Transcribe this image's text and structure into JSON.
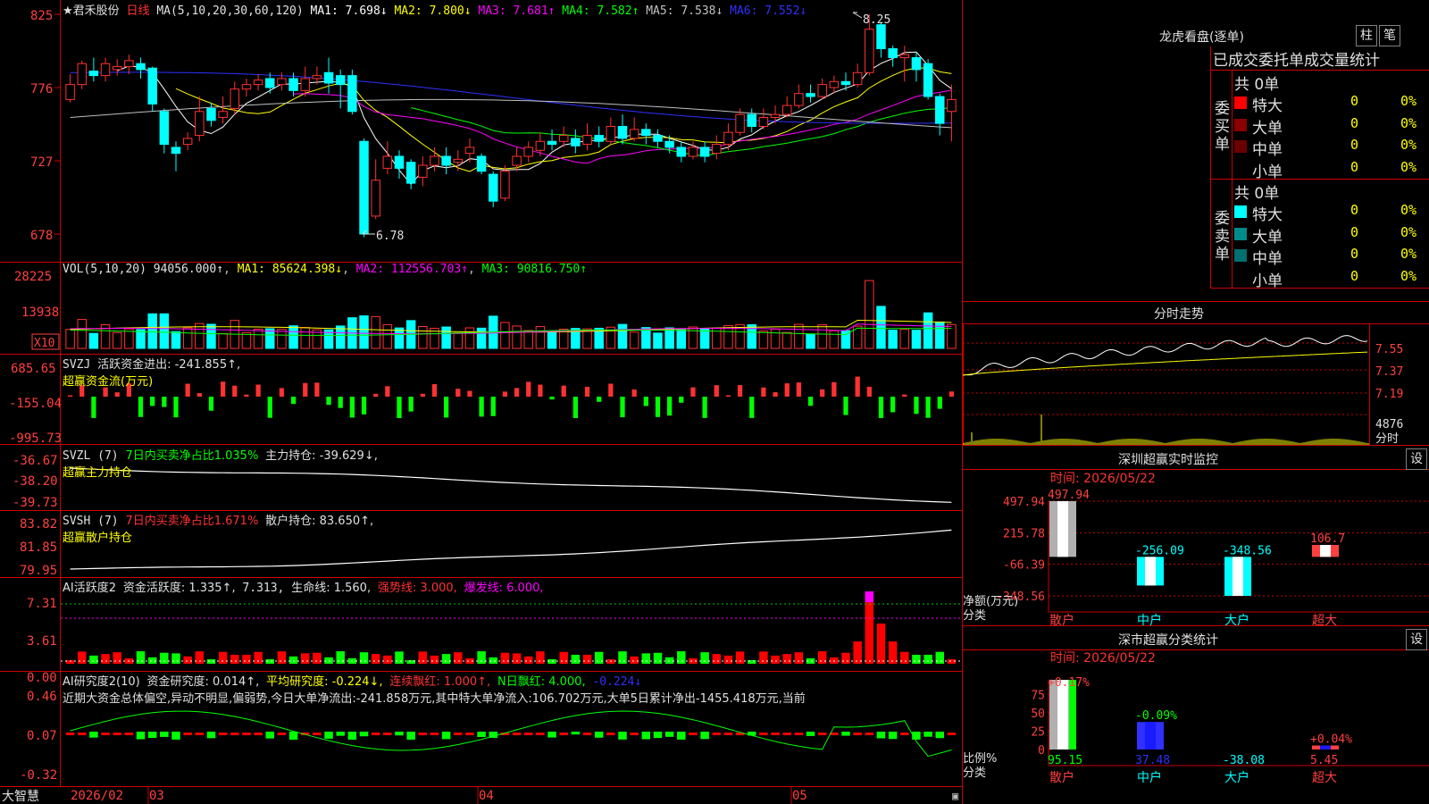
{
  "colors": {
    "up": "#ff3232",
    "down": "#00ffff",
    "grid": "#cc0000",
    "axis_text": "#ff4040",
    "bg": "#000000",
    "ma1": "#ffffff",
    "ma2": "#ffff00",
    "ma3": "#ff00ff",
    "ma4": "#00ff00",
    "ma5": "#c0c0c0",
    "ma6": "#3030ff"
  },
  "main": {
    "stock_name": "★君禾股份",
    "period": "日线",
    "ma_label": "MA(5,10,20,30,60,120)",
    "legend": [
      {
        "key": "ma1",
        "text": "MA1: 7.698↓",
        "color": "#ffffff"
      },
      {
        "key": "ma2",
        "text": "MA2: 7.800↓",
        "color": "#ffff00"
      },
      {
        "key": "ma3",
        "text": "MA3: 7.681↑",
        "color": "#ff00ff"
      },
      {
        "key": "ma4",
        "text": "MA4: 7.582↑",
        "color": "#00ff00"
      },
      {
        "key": "ma5",
        "text": "MA5: 7.538↓",
        "color": "#c0c0c0"
      },
      {
        "key": "ma6",
        "text": "MA6: 7.552↓",
        "color": "#3030ff"
      }
    ],
    "y_ticks": [
      "825",
      "776",
      "727",
      "678"
    ],
    "high_marker": "8.25",
    "low_marker": "6.78"
  },
  "vol": {
    "header": "VOL(5,10,20)",
    "value": "94056.000↑",
    "legend": [
      {
        "text": "MA1: 85624.398↓",
        "color": "#ffff00"
      },
      {
        "text": "MA2: 112556.703↑",
        "color": "#ff00ff"
      },
      {
        "text": "MA3: 90816.750↑",
        "color": "#00ff00"
      }
    ],
    "y_ticks": [
      "28225",
      "13938"
    ],
    "unit": "X10"
  },
  "svzj": {
    "header": "SVZJ",
    "line1": "活跃资金进出: -241.855↑,",
    "line2": "超赢资金流(万元)",
    "y_ticks": [
      "685.65",
      "-155.04",
      "-995.73"
    ]
  },
  "svzl": {
    "header": "SVZL (7)",
    "pct": "7日内买卖净占比1.035%",
    "hold": "主力持仓: -39.629↓,",
    "line2": "超赢主力持仓",
    "y_ticks": [
      "-36.67",
      "-38.20",
      "-39.73"
    ]
  },
  "svsh": {
    "header": "SVSH (7)",
    "pct": "7日内买卖净占比1.671%",
    "hold": "散户持仓: 83.650↑,",
    "line2": "超赢散户持仓",
    "y_ticks": [
      "83.82",
      "81.85",
      "79.95"
    ]
  },
  "ai1": {
    "header": "AI活跃度2",
    "a": "资金活跃度: 1.335↑,",
    "b": "7.313,",
    "c": "生命线: 1.560,",
    "d": "强势线: 3.000,",
    "e": "爆发线: 6.000,",
    "y_ticks": [
      "7.31",
      "3.61",
      "0.00"
    ]
  },
  "ai2": {
    "header": "AI研究度2(10)",
    "a": "资金研究度: 0.014↑,",
    "b": "平均研究度: -0.224↓,",
    "c": "连续飘红: 1.000↑,",
    "d": "N日飘红: 4.000,",
    "e": "-0.224↓",
    "text": "近期大资金总体偏空,异动不明显,偏弱势,今日大单净流出:-241.858万元,其中特大单净流入:106.702万元,大单5日累计净出-1455.418万元,当前",
    "y_ticks": [
      "0.46",
      "0.07",
      "-0.32"
    ]
  },
  "bottom": {
    "brand": "大智慧",
    "labels": [
      "2026/02",
      "03",
      "04",
      "05"
    ]
  },
  "right": {
    "dragon": {
      "title": "龙虎看盘(逐单)",
      "btn1": "柱",
      "btn2": "笔",
      "sub": "已成交委托单成交量统计",
      "buy": {
        "label": "委买单",
        "count": "共 0单",
        "rows": [
          {
            "name": "特大",
            "val": "0",
            "pct": "0%"
          },
          {
            "name": "大单",
            "val": "0",
            "pct": "0%"
          },
          {
            "name": "中单",
            "val": "0",
            "pct": "0%"
          },
          {
            "name": "小单",
            "val": "0",
            "pct": "0%"
          }
        ]
      },
      "sell": {
        "label": "委卖单",
        "count": "共 0单",
        "rows": [
          {
            "name": "特大",
            "val": "0",
            "pct": "0%"
          },
          {
            "name": "大单",
            "val": "0",
            "pct": "0%"
          },
          {
            "name": "中单",
            "val": "0",
            "pct": "0%"
          },
          {
            "name": "小单",
            "val": "0",
            "pct": "0%"
          }
        ]
      }
    },
    "intraday": {
      "title": "分时走势",
      "y_ticks": [
        "7.55",
        "7.37",
        "7.19"
      ],
      "vol_tick": "4876",
      "vol_unit": "分时"
    },
    "sz_monitor": {
      "title": "深圳超赢实时监控",
      "btn": "设",
      "time": "时间: 2026/05/22",
      "y_ticks": [
        "497.94",
        "215.78",
        "-66.39",
        "-348.56"
      ],
      "ylabel": "净额(万元)",
      "xlabel": "分类"
    },
    "sz_class": {
      "title": "深市超赢分类统计",
      "btn": "设",
      "time": "时间: 2026/05/22",
      "y_ticks": [
        "75",
        "50",
        "25",
        "0"
      ],
      "ylabel": "比例%",
      "xlabel": "分类"
    }
  },
  "chart_data": [
    {
      "type": "bar",
      "name": "深圳超赢实时监控",
      "categories": [
        "散户",
        "中户",
        "大户",
        "超大"
      ],
      "values": [
        497.94,
        -256.09,
        -348.56,
        106.7
      ],
      "ylim": [
        -348.56,
        497.94
      ],
      "ylabel": "净额(万元)",
      "xlabel": "分类",
      "time": "2026/05/22"
    },
    {
      "type": "bar",
      "name": "深市超赢分类统计",
      "categories": [
        "散户",
        "中户",
        "大户",
        "超大"
      ],
      "values": [
        95.15,
        37.48,
        -38.08,
        5.45
      ],
      "bar_labels": [
        "+0.17%",
        "-0.09%",
        "",
        "+0.04%"
      ],
      "ylim": [
        0,
        95
      ],
      "ylabel": "比例%",
      "xlabel": "分类",
      "time": "2026/05/22"
    },
    {
      "type": "candlestick",
      "name": "君禾股份 日线",
      "ylim": [
        6.78,
        8.25
      ],
      "y_ticks": [
        8.25,
        7.76,
        7.27,
        6.78
      ],
      "x_labels": [
        "2026/02",
        "03",
        "04",
        "05"
      ],
      "labelled": {
        "high": 8.25,
        "low": 6.78
      }
    }
  ]
}
